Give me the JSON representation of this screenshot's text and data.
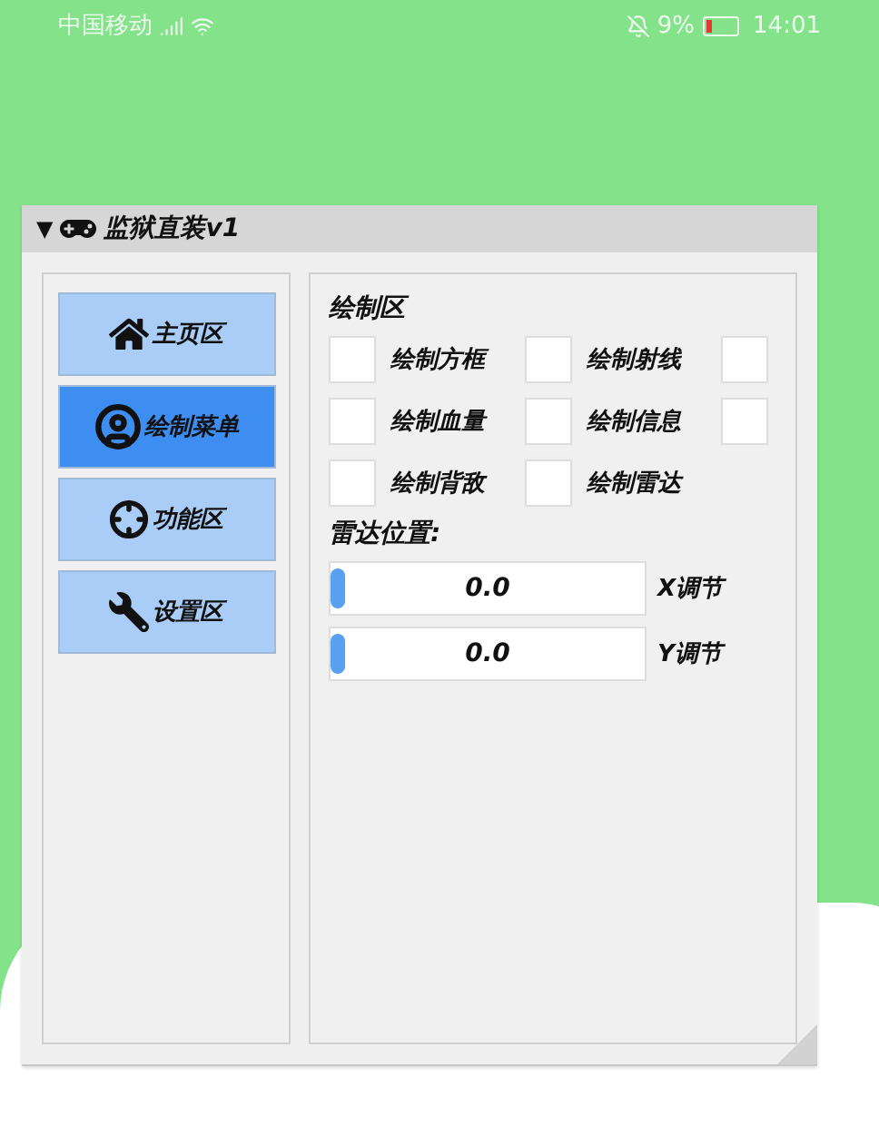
{
  "status_bar": {
    "carrier": "中国移动",
    "battery": "9%",
    "time": "14:01"
  },
  "window": {
    "toggle": "▼",
    "title": "监狱直装v1",
    "expanded": true
  },
  "nav": [
    {
      "label": "主页区",
      "selected": false
    },
    {
      "label": "绘制菜单",
      "selected": true
    },
    {
      "label": "功能区",
      "selected": false
    },
    {
      "label": "设置区",
      "selected": false
    }
  ],
  "section_title": "绘制区",
  "options": [
    {
      "label": "绘制方框",
      "checked": false
    },
    {
      "label": "绘制射线",
      "checked": false
    },
    {
      "checked": false
    },
    {
      "label": "绘制血量",
      "checked": false
    },
    {
      "label": "绘制信息",
      "checked": false
    },
    {
      "checked": false
    },
    {
      "label": "绘制背敌",
      "checked": false
    },
    {
      "label": "绘制雷达",
      "checked": false
    }
  ],
  "radar_title": "雷达位置:",
  "sliders": [
    {
      "value": "0.0",
      "label": "X调节",
      "level": 0
    },
    {
      "value": "0.0",
      "label": "Y调节",
      "level": 0
    }
  ]
}
